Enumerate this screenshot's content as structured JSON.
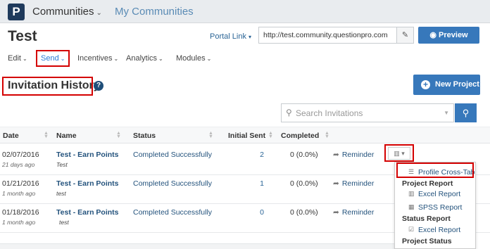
{
  "topbar": {
    "logo_letter": "P",
    "communities_label": "Communities",
    "communities_chevron": "⌄",
    "my_communities_label": "My Communities"
  },
  "header": {
    "title": "Test",
    "portal_link_label": "Portal Link",
    "portal_url": "http://test.community.questionpro.com",
    "preview_label": "Preview"
  },
  "nav": [
    {
      "label": "Edit",
      "active": false
    },
    {
      "label": "Send",
      "active": true
    },
    {
      "label": "Incentives",
      "active": false
    },
    {
      "label": "Analytics",
      "active": false
    },
    {
      "label": "Modules",
      "active": false
    }
  ],
  "section": {
    "title": "Invitation History",
    "help_glyph": "?",
    "new_project_label": "New Project"
  },
  "search": {
    "placeholder": "Search Invitations"
  },
  "table": {
    "headers": {
      "date": "Date",
      "name": "Name",
      "status": "Status",
      "initial_sent": "Initial Sent",
      "completed": "Completed"
    },
    "rows": [
      {
        "date": "02/07/2016",
        "ago": "21 days ago",
        "name": "Test - Earn Points",
        "sub": "Test",
        "status": "Completed Successfully",
        "initial_sent": "2",
        "completed": "0 (0.0%)",
        "reminder": "Reminder"
      },
      {
        "date": "01/21/2016",
        "ago": "1 month ago",
        "name": "Test - Earn Points",
        "sub": "test",
        "status": "Completed Successfully",
        "initial_sent": "1",
        "completed": "0 (0.0%)",
        "reminder": "Reminder"
      },
      {
        "date": "01/18/2016",
        "ago": "1 month ago",
        "name": "Test - Earn Points",
        "sub": "test",
        "status": "Completed Successfully",
        "initial_sent": "0",
        "completed": "0 (0.0%)",
        "reminder": "Reminder"
      }
    ]
  },
  "dropdown": {
    "profile_crosstab": "Profile Cross-Tab",
    "project_report_heading": "Project Report",
    "excel_report": "Excel Report",
    "spss_report": "SPSS Report",
    "status_report_heading": "Status Report",
    "status_excel_report": "Excel Report",
    "project_status_heading": "Project Status"
  },
  "colors": {
    "accent": "#3778bb",
    "link": "#23527c",
    "highlight_box": "#d40000"
  }
}
